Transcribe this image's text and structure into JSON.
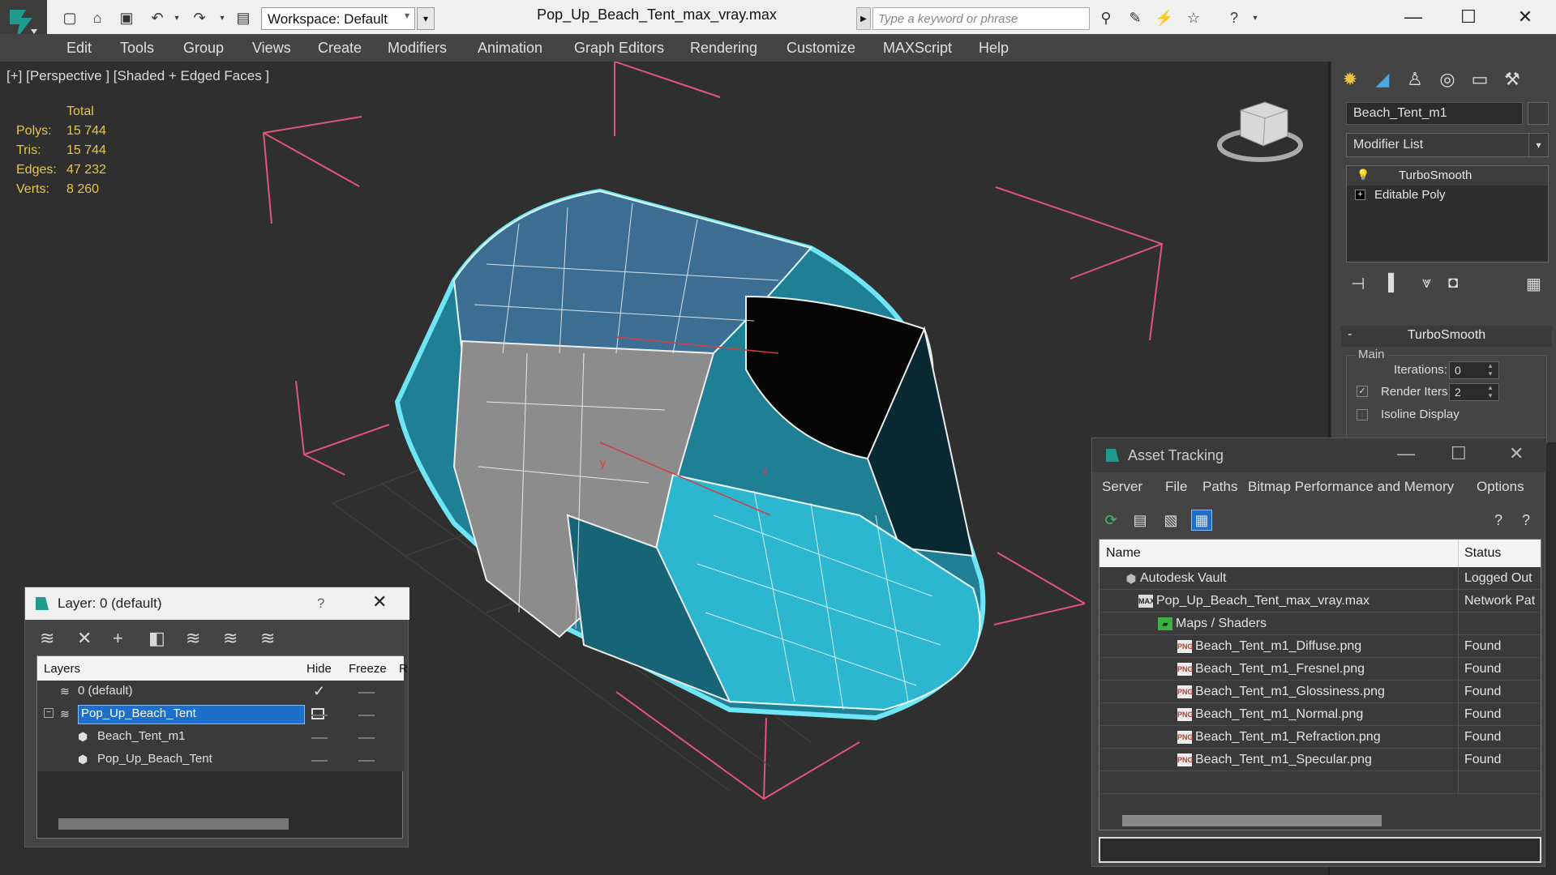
{
  "app": {
    "doc_title": "Pop_Up_Beach_Tent_max_vray.max",
    "workspace": "Workspace: Default",
    "search_placeholder": "Type a keyword or phrase",
    "accent": "#1e6ecb"
  },
  "menu": [
    "Edit",
    "Tools",
    "Group",
    "Views",
    "Create",
    "Modifiers",
    "Animation",
    "Graph Editors",
    "Rendering",
    "Customize",
    "MAXScript",
    "Help"
  ],
  "viewport": {
    "label": "[+] [Perspective ] [Shaded + Edged Faces ]",
    "stats_header": "Total",
    "stats": [
      {
        "label": "Polys:",
        "value": "15 744"
      },
      {
        "label": "Tris:",
        "value": "15 744"
      },
      {
        "label": "Edges:",
        "value": "47 232"
      },
      {
        "label": "Verts:",
        "value": "8 260"
      }
    ]
  },
  "command_panel": {
    "object_name": "Beach_Tent_m1",
    "modifier_list": "Modifier List",
    "stack": [
      "TurboSmooth",
      "Editable Poly"
    ],
    "rollout_title": "TurboSmooth",
    "group_label": "Main",
    "iterations_label": "Iterations:",
    "iterations_value": "0",
    "render_iters_label": "Render Iters:",
    "render_iters_value": "2",
    "isoline_label": "Isoline Display"
  },
  "layer_dialog": {
    "title": "Layer: 0 (default)",
    "help": "?",
    "columns": [
      "Layers",
      "Hide",
      "Freeze",
      "R"
    ],
    "rows": [
      {
        "name": "0 (default)",
        "indent": 0,
        "checked": true
      },
      {
        "name": "Pop_Up_Beach_Tent",
        "indent": 0,
        "selected": true
      },
      {
        "name": "Beach_Tent_m1",
        "indent": 1
      },
      {
        "name": "Pop_Up_Beach_Tent",
        "indent": 1
      }
    ]
  },
  "asset_dialog": {
    "title": "Asset Tracking",
    "menu": [
      "Server",
      "File",
      "Paths",
      "Bitmap Performance and Memory",
      "Options"
    ],
    "columns": {
      "name": "Name",
      "status": "Status"
    },
    "rows": [
      {
        "name": "Autodesk Vault",
        "status": "Logged Out",
        "icon": "vault-icon",
        "level": 1
      },
      {
        "name": "Pop_Up_Beach_Tent_max_vray.max",
        "status": "Network Pat",
        "icon": "max-file-icon",
        "level": 2
      },
      {
        "name": "Maps / Shaders",
        "status": "",
        "icon": "maps-icon",
        "level": 3
      },
      {
        "name": "Beach_Tent_m1_Diffuse.png",
        "status": "Found",
        "icon": "png-icon",
        "level": 4
      },
      {
        "name": "Beach_Tent_m1_Fresnel.png",
        "status": "Found",
        "icon": "png-icon",
        "level": 4
      },
      {
        "name": "Beach_Tent_m1_Glossiness.png",
        "status": "Found",
        "icon": "png-icon",
        "level": 4
      },
      {
        "name": "Beach_Tent_m1_Normal.png",
        "status": "Found",
        "icon": "png-icon",
        "level": 4
      },
      {
        "name": "Beach_Tent_m1_Refraction.png",
        "status": "Found",
        "icon": "png-icon",
        "level": 4
      },
      {
        "name": "Beach_Tent_m1_Specular.png",
        "status": "Found",
        "icon": "png-icon",
        "level": 4
      }
    ]
  }
}
